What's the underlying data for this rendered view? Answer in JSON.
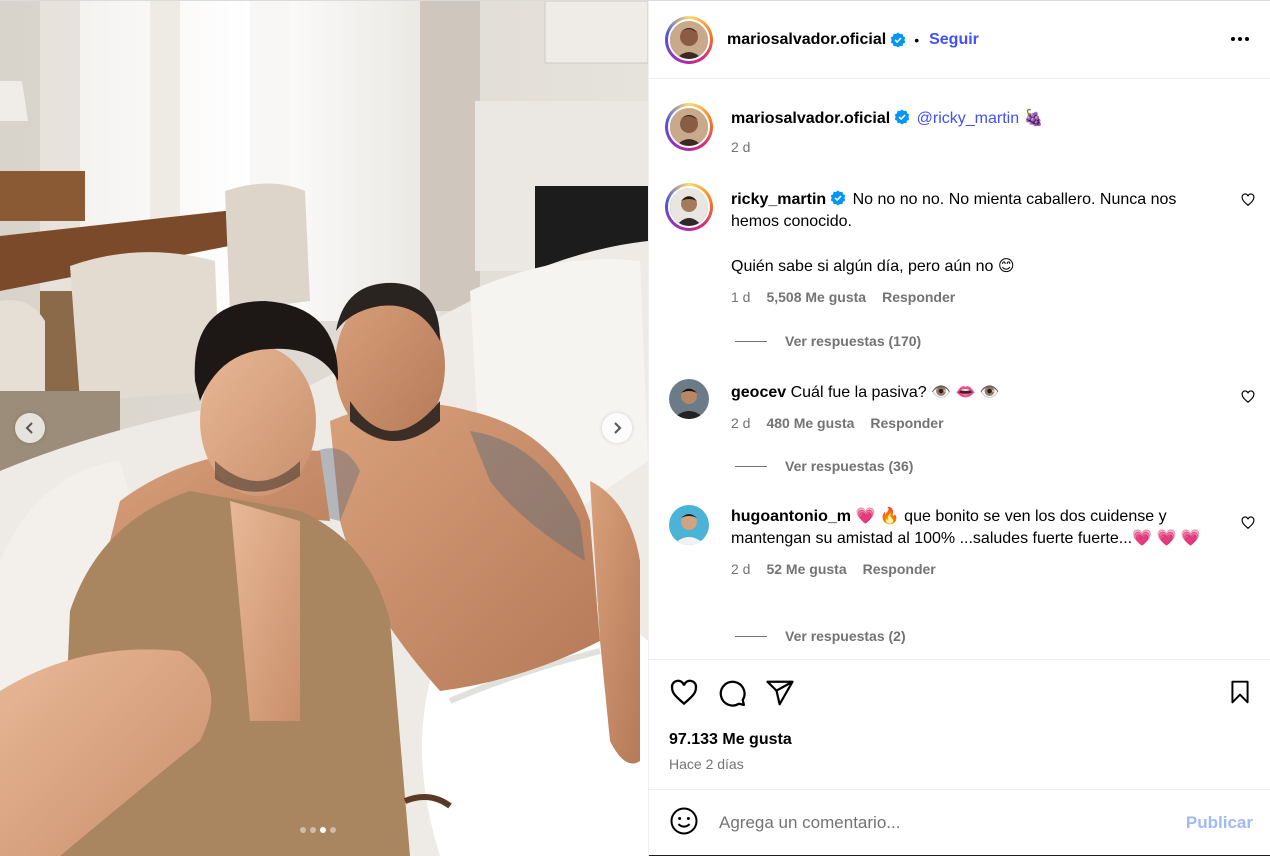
{
  "post": {
    "author": "mariosalvador.oficial",
    "follow_label": "Seguir",
    "separator": "•",
    "more_icon": "more-horizontal-icon"
  },
  "caption": {
    "user": "mariosalvador.oficial",
    "mention": "@ricky_martin",
    "emoji": "🍇",
    "time": "2 d"
  },
  "comments": [
    {
      "user": "ricky_martin",
      "verified": true,
      "text_line1": "No no no no. No mienta caballero. Nunca nos hemos conocido.",
      "text_line2": "Quién sabe si algún día, pero aún no 😊",
      "time": "1 d",
      "likes": "5,508 Me gusta",
      "reply_label": "Responder",
      "view_replies": "Ver respuestas (170)"
    },
    {
      "user": "geocev",
      "verified": false,
      "text_line1": "Cuál fue la pasiva? 👁️ 👄 👁️",
      "time": "2 d",
      "likes": "480 Me gusta",
      "reply_label": "Responder",
      "view_replies": "Ver respuestas (36)"
    },
    {
      "user": "hugoantonio_m",
      "verified": false,
      "text_line1": "💗 🔥 que bonito se ven los dos cuidense y mantengan su amistad al 100% ...saludes fuerte fuerte...💗 💗 💗",
      "time": "2 d",
      "likes": "52 Me gusta",
      "reply_label": "Responder",
      "view_replies": "Ver respuestas (2)"
    }
  ],
  "engagement": {
    "likes": "97.133 Me gusta",
    "posted": "Hace 2 días"
  },
  "composer": {
    "placeholder": "Agrega un comentario...",
    "publish_label": "Publicar"
  },
  "carousel": {
    "slide_count": 4,
    "active_slide": 3
  },
  "colors": {
    "accent": "#4150f7",
    "muted": "#737373",
    "publish_disabled": "#a3b8f8",
    "heart_pink": "#e8457a"
  }
}
